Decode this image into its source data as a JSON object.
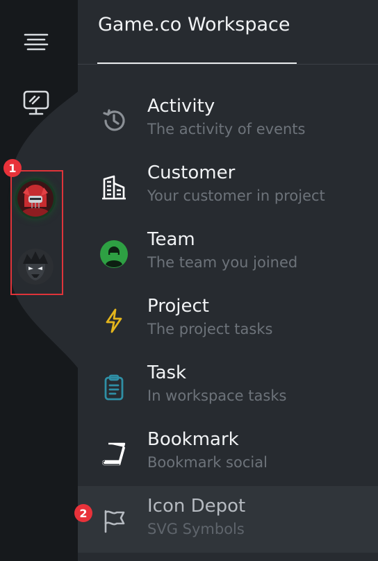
{
  "workspace": {
    "title": "Game.co Workspace"
  },
  "annotations": {
    "badge_1": "1",
    "badge_2": "2"
  },
  "rail": {
    "menu_icon": "hamburger-menu-icon",
    "display_icon": "monitor-icon",
    "avatars": [
      "red-knight-avatar",
      "dark-warrior-avatar"
    ]
  },
  "menu": {
    "items": [
      {
        "title": "Activity",
        "subtitle": "The activity of events",
        "icon": "history-icon",
        "color": "#8b9096"
      },
      {
        "title": "Customer",
        "subtitle": "Your customer in project",
        "icon": "building-icon",
        "color": "#ffffff"
      },
      {
        "title": "Team",
        "subtitle": "The team you joined",
        "icon": "team-icon",
        "color": "#2ea043"
      },
      {
        "title": "Project",
        "subtitle": "The project tasks",
        "icon": "lightning-icon",
        "color": "#e3b51c"
      },
      {
        "title": "Task",
        "subtitle": "In workspace tasks",
        "icon": "clipboard-icon",
        "color": "#2f8fa5"
      },
      {
        "title": "Bookmark",
        "subtitle": "Bookmark social",
        "icon": "book-icon",
        "color": "#ffffff"
      },
      {
        "title": "Icon Depot",
        "subtitle": "SVG Symbols",
        "icon": "flag-icon",
        "color": "#b6bbc1",
        "active": true
      }
    ]
  },
  "colors": {
    "rail_bg": "#16191c",
    "rail_bulge": "#272b30",
    "panel_bg": "#272b30",
    "active_bg": "#30353a",
    "annotation_red": "#e8323a"
  }
}
